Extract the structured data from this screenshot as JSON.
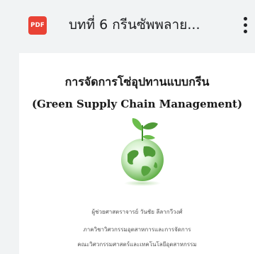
{
  "file": {
    "type_badge": "PDF",
    "title": "บทที่ 6 กรีนซัพพลาย..."
  },
  "icons": {
    "file_type": "pdf-file-icon",
    "more": "more-vert-icon",
    "cover": "globe-with-sprout-icon"
  },
  "colors": {
    "pdf_badge": "#e94235",
    "header_bg": "#f1f3f4",
    "page_bg": "#ffffff"
  },
  "document": {
    "title_th": "การจัดการโซ่อุปทานแบบกรีน",
    "title_en": "(Green Supply Chain Management)",
    "author_lines": [
      "ผู้ช่วยศาสตราจารย์ วันชัย ลีลากวีวงศ์",
      "ภาควิชาวิศวกรรมอุตสาหการและการจัดการ",
      "คณะวิศวกรรมศาสตร์และเทคโนโลยีอุตสาหกรรม"
    ]
  }
}
